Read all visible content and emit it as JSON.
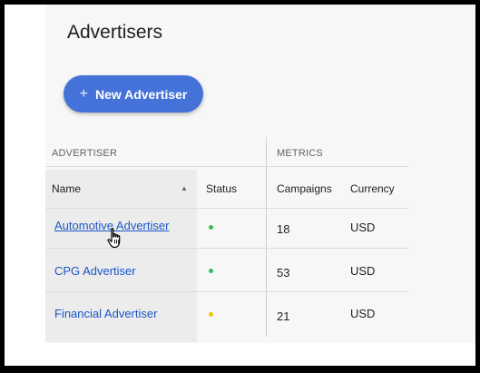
{
  "page": {
    "title": "Advertisers"
  },
  "toolbar": {
    "new_button_label": "New Advertiser",
    "new_button_icon": "plus-icon"
  },
  "table": {
    "groups": {
      "advertiser": "ADVERTISER",
      "metrics": "METRICS"
    },
    "columns": {
      "name": "Name",
      "status": "Status",
      "campaigns": "Campaigns",
      "currency": "Currency"
    },
    "sort": {
      "column": "Name",
      "direction": "ascending"
    },
    "rows": [
      {
        "name": "Automotive Advertiser",
        "status_color": "#3cba54",
        "campaigns": "18",
        "currency": "USD"
      },
      {
        "name": "CPG Advertiser",
        "status_color": "#3cba54",
        "campaigns": "53",
        "currency": "USD"
      },
      {
        "name": "Financial Advertiser",
        "status_color": "#f4c20d",
        "campaigns": "21",
        "currency": "USD"
      }
    ]
  },
  "colors": {
    "accent": "#4472d8",
    "link": "#1a56c7"
  },
  "cursor": {
    "icon": "hand-pointer-icon",
    "over": "Automotive Advertiser"
  }
}
